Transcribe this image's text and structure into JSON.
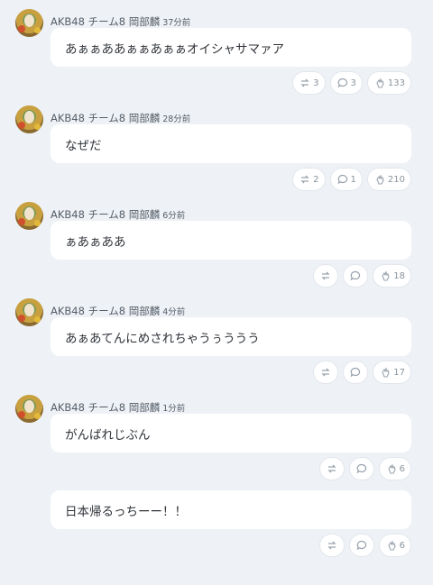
{
  "author": "AKB48 チーム8 岡部麟",
  "posts": [
    {
      "time": "37分前",
      "text": "あぁぁああぁぁあぁぁオイシャサマァア",
      "retweets": "3",
      "comments": "3",
      "likes": "133"
    },
    {
      "time": "28分前",
      "text": "なぜだ",
      "retweets": "2",
      "comments": "1",
      "likes": "210"
    },
    {
      "time": "6分前",
      "text": "ぁあぁああ",
      "retweets": "",
      "comments": "",
      "likes": "18"
    },
    {
      "time": "4分前",
      "text": "あぁあてんにめされちゃうぅううう",
      "retweets": "",
      "comments": "",
      "likes": "17"
    },
    {
      "time": "1分前",
      "text": "がんばれじぶん",
      "retweets": "",
      "comments": "",
      "likes": "6"
    },
    {
      "time": "",
      "text": "日本帰るっちーー！！",
      "retweets": "",
      "comments": "",
      "likes": "6"
    }
  ],
  "icons": {
    "retweet": "retweet-icon",
    "comment": "comment-icon",
    "like": "clap-icon"
  }
}
